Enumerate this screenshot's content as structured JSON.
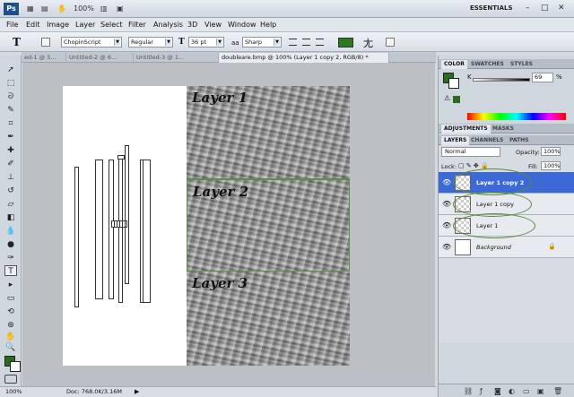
{
  "titlebar": {
    "logo": "Ps",
    "zoom": "100%",
    "workspace": "ESSENTIALS",
    "min": "–",
    "max": "□",
    "close": "✕"
  },
  "menus": [
    "File",
    "Edit",
    "Image",
    "Layer",
    "Select",
    "Filter",
    "Analysis",
    "3D",
    "View",
    "Window",
    "Help"
  ],
  "options": {
    "font_family": "ChopinScript",
    "font_style": "Regular",
    "font_size": "36 pt",
    "aa_label": "aa",
    "antialias": "Sharp",
    "text_color": "#2a7a1f"
  },
  "tabs": [
    "ed-1 @ 5...",
    "Untitled-2 @ 6...",
    "Untitled-3 @ 1...",
    "doubleare.bmp @ 100% (Layer 1 copy 2, RGB/8) *"
  ],
  "canvas": {
    "layer_labels": [
      "Layer 1",
      "Layer 2",
      "Layer 3"
    ]
  },
  "status": {
    "zoom": "100%",
    "doc": "Doc: 768.0K/3.16M"
  },
  "color_panel": {
    "tabs": [
      "COLOR",
      "SWATCHES",
      "STYLES"
    ],
    "k_label": "K",
    "k_value": "69",
    "k_unit": "%",
    "fg": "#2a6b1e"
  },
  "adjust_tabs": [
    "ADJUSTMENTS",
    "MASKS"
  ],
  "layers_panel": {
    "tabs": [
      "LAYERS",
      "CHANNELS",
      "PATHS"
    ],
    "blend_mode": "Normal",
    "opacity_label": "Opacity:",
    "opacity": "100%",
    "lock_label": "Lock:",
    "fill_label": "Fill:",
    "fill": "100%",
    "layers": [
      "Layer 1 copy 2",
      "Layer 1 copy",
      "Layer 1",
      "Background"
    ]
  }
}
